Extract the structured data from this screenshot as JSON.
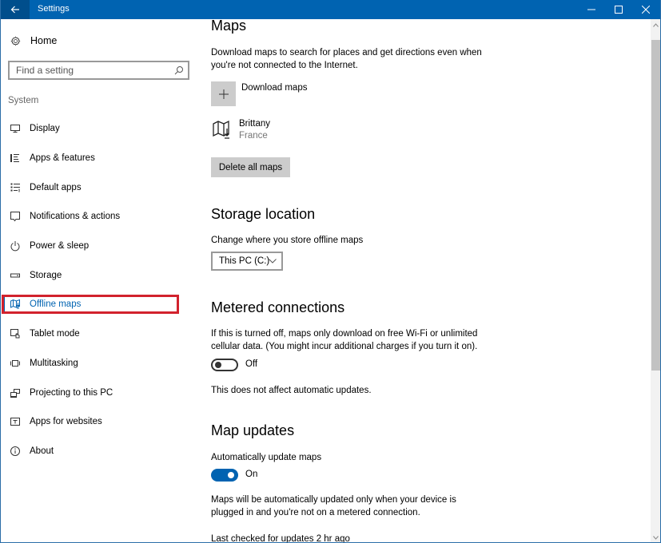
{
  "window": {
    "title": "Settings",
    "controls": {
      "back": "back-arrow-icon",
      "minimize": "minimize-icon",
      "maximize": "maximize-icon",
      "close": "close-icon"
    }
  },
  "sidebar": {
    "home_label": "Home",
    "search": {
      "placeholder": "Find a setting",
      "value": ""
    },
    "section_label": "System",
    "items": [
      {
        "label": "Display",
        "icon": "display-icon",
        "active": false
      },
      {
        "label": "Apps & features",
        "icon": "apps-features-icon",
        "active": false
      },
      {
        "label": "Default apps",
        "icon": "default-apps-icon",
        "active": false
      },
      {
        "label": "Notifications & actions",
        "icon": "notifications-icon",
        "active": false
      },
      {
        "label": "Power & sleep",
        "icon": "power-icon",
        "active": false
      },
      {
        "label": "Storage",
        "icon": "storage-icon",
        "active": false
      },
      {
        "label": "Offline maps",
        "icon": "map-icon",
        "active": true
      },
      {
        "label": "Tablet mode",
        "icon": "tablet-mode-icon",
        "active": false
      },
      {
        "label": "Multitasking",
        "icon": "multitasking-icon",
        "active": false
      },
      {
        "label": "Projecting to this PC",
        "icon": "projecting-icon",
        "active": false
      },
      {
        "label": "Apps for websites",
        "icon": "apps-websites-icon",
        "active": false
      },
      {
        "label": "About",
        "icon": "info-icon",
        "active": false
      }
    ]
  },
  "main": {
    "maps": {
      "heading": "Maps",
      "description": "Download maps to search for places and get directions even when you're not connected to the Internet.",
      "download_label": "Download maps",
      "downloaded": [
        {
          "name": "Brittany",
          "country": "France"
        }
      ],
      "delete_all_label": "Delete all maps"
    },
    "storage": {
      "heading": "Storage location",
      "label": "Change where you store offline maps",
      "selected": "This PC (C:)"
    },
    "metered": {
      "heading": "Metered connections",
      "description": "If this is turned off, maps only download on free Wi-Fi or unlimited cellular data. (You might incur additional charges if you turn it on).",
      "toggle_state": "Off",
      "note": "This does not affect automatic updates."
    },
    "updates": {
      "heading": "Map updates",
      "label": "Automatically update maps",
      "toggle_state": "On",
      "description": "Maps will be automatically updated only when your device is plugged in and you're not on a metered connection.",
      "last_checked": "Last checked for updates 2 hr ago"
    }
  },
  "colors": {
    "accent": "#0063b1",
    "titlebar": "#0063b1",
    "highlight": "#d2222d",
    "button_gray": "#cccccc"
  }
}
